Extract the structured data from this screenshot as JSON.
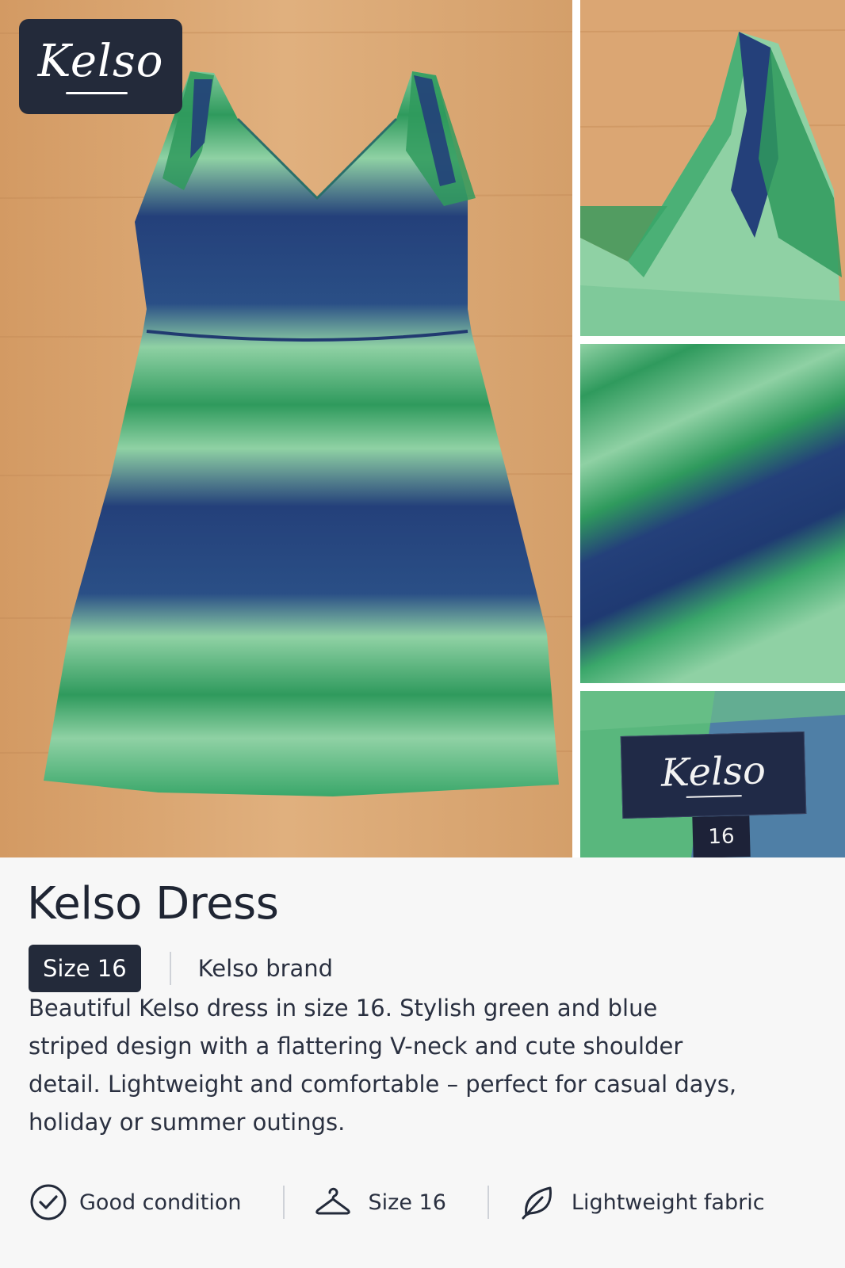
{
  "brand_badge": {
    "text": "Kelso"
  },
  "gallery": {
    "label_photo": {
      "brand": "Kelso",
      "size": "16"
    }
  },
  "product": {
    "title": "Kelso Dress",
    "size_chip": "Size 16",
    "brand_text": "Kelso brand",
    "description": "Beautiful Kelso dress in size 16. Stylish green and blue striped design with a flattering V-neck and cute shoulder detail. Lightweight and comfortable – perfect for casual days, holiday or summer outings."
  },
  "features": [
    {
      "icon": "check-circle-icon",
      "label": "Good condition"
    },
    {
      "icon": "hanger-icon",
      "label": "Size 16"
    },
    {
      "icon": "leaf-icon",
      "label": "Lightweight fabric"
    }
  ],
  "colors": {
    "navy": "#232a3a",
    "green_stripe": "#2f9a5d",
    "light_green": "#8fd1a4",
    "blue_stripe": "#24407a",
    "wood": "#d9a46f",
    "background": "#f7f7f7"
  }
}
